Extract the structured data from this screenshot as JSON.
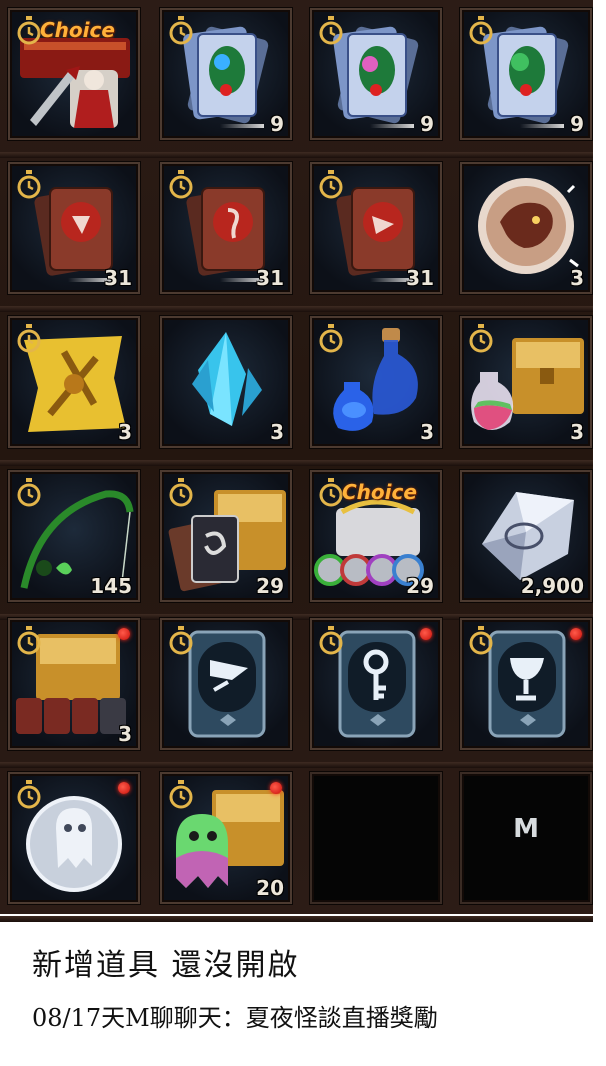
{
  "inventory": {
    "rows": [
      [
        {
          "item": "choice-weapon-box-icon",
          "choice_label": "Choice",
          "timed": true
        },
        {
          "item": "card-pack-icon",
          "qty": "9",
          "timed": true
        },
        {
          "item": "card-pack-icon",
          "qty": "9",
          "timed": true
        },
        {
          "item": "card-pack-icon",
          "qty": "9",
          "timed": true
        }
      ],
      [
        {
          "item": "red-card-pack-icon",
          "qty": "31",
          "timed": true
        },
        {
          "item": "red-card-pack-icon",
          "qty": "31",
          "timed": true
        },
        {
          "item": "red-card-pack-icon",
          "qty": "31",
          "timed": true
        },
        {
          "item": "dragon-orb-icon",
          "qty": "3",
          "timed": false
        }
      ],
      [
        {
          "item": "gold-scroll-icon",
          "qty": "3",
          "timed": true
        },
        {
          "item": "blue-crystal-icon",
          "qty": "3",
          "timed": false
        },
        {
          "item": "blue-potion-icon",
          "qty": "3",
          "timed": true
        },
        {
          "item": "potion-chest-icon",
          "qty": "3",
          "timed": true
        }
      ],
      [
        {
          "item": "fishing-rod-icon",
          "qty": "145",
          "timed": true
        },
        {
          "item": "card-chest-icon",
          "qty": "29",
          "timed": true
        },
        {
          "item": "choice-coin-chest-icon",
          "choice_label": "Choice",
          "qty": "29",
          "timed": true
        },
        {
          "item": "silver-gem-icon",
          "qty": "2,900",
          "timed": false
        }
      ],
      [
        {
          "item": "chest-with-cards-icon",
          "qty": "3",
          "timed": true,
          "new": true
        },
        {
          "item": "flag-card-icon",
          "timed": true,
          "new": false
        },
        {
          "item": "key-card-icon",
          "timed": true,
          "new": true
        },
        {
          "item": "goblet-card-icon",
          "timed": true,
          "new": true
        }
      ],
      [
        {
          "item": "ghost-coin-icon",
          "timed": true,
          "new": true
        },
        {
          "item": "ghost-chest-icon",
          "qty": "20",
          "timed": true,
          "new": true
        },
        {
          "item": "empty-slot"
        },
        {
          "item": "empty-slot",
          "label": "M"
        }
      ]
    ]
  },
  "caption": {
    "title": "新增道具 還沒開啟",
    "subtitle": "08/17天M聊聊天：夏夜怪談直播獎勵"
  },
  "colors": {
    "panel_bg": "#2a1a14",
    "slot_border": "#4c3a30",
    "timer_gold": "#e3b54a",
    "new_badge": "#e01a10",
    "qty_text": "#ece6da"
  }
}
